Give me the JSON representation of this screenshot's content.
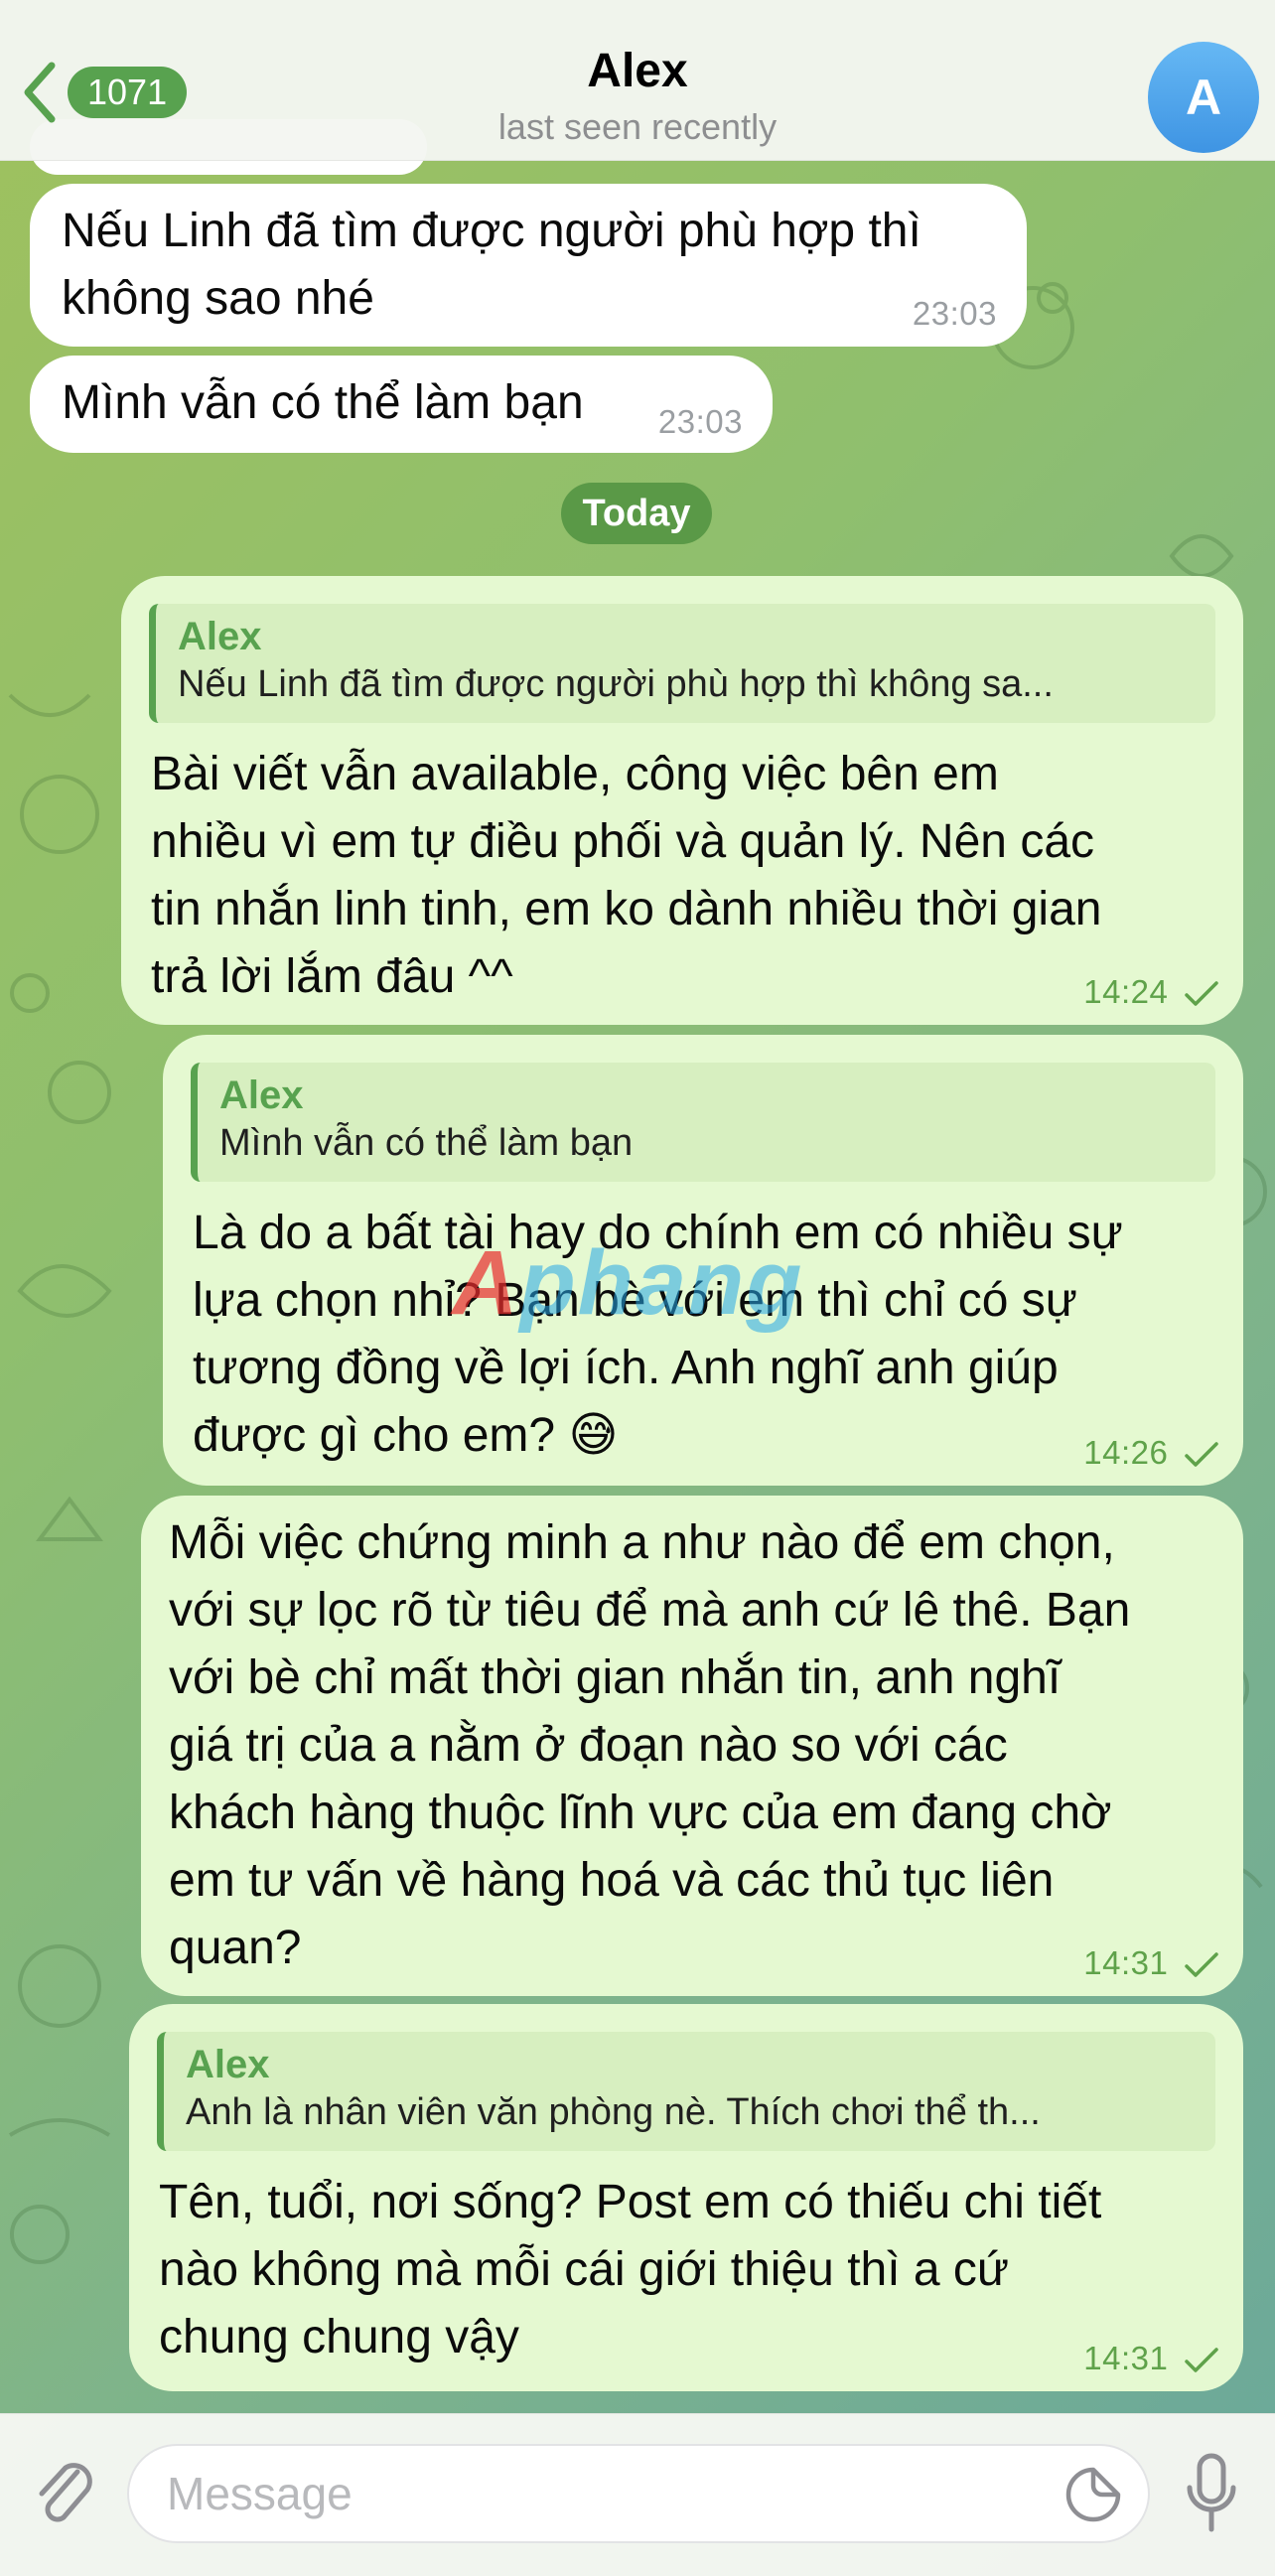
{
  "header": {
    "unread_count": "1071",
    "contact_name": "Alex",
    "status": "last seen recently",
    "avatar_letter": "A"
  },
  "messages": {
    "m1": {
      "text_line1": "Nếu Linh đã tìm được người phù hợp thì",
      "text_line2": "không sao nhé",
      "time": "23:03"
    },
    "m2": {
      "text": "Mình vẫn có thể làm bạn",
      "time": "23:03"
    },
    "day_separator": "Today",
    "m3": {
      "reply_name": "Alex",
      "reply_text": "Nếu Linh đã tìm được người phù hợp thì không sa...",
      "lines": [
        "Bài viết vẫn available, công việc bên em",
        "nhiều vì em tự điều phối và quản lý. Nên các",
        "tin nhắn linh tinh, em ko dành nhiều thời gian",
        "trả lời lắm đâu ^^"
      ],
      "time": "14:24"
    },
    "m4": {
      "reply_name": "Alex",
      "reply_text": "Mình vẫn có thể làm bạn",
      "lines": [
        "Là do a bất tài hay do chính em có nhiều sự",
        "lựa chọn nhỉ? Bạn bè với em thì chỉ có sự",
        "tương đồng về lợi ích. Anh nghĩ anh giúp",
        "được gì cho em? 😅"
      ],
      "time": "14:26"
    },
    "m5": {
      "lines": [
        "Mỗi việc chứng minh a như nào để em chọn,",
        "với sự lọc rõ từ tiêu để mà anh cứ lê thê. Bạn",
        "với bè chỉ mất thời gian nhắn tin, anh nghĩ",
        "giá trị của a nằm ở đoạn nào so với các",
        "khách hàng thuộc lĩnh vực của em đang chờ",
        "em tư vấn về hàng hoá và các thủ tục liên",
        "quan?"
      ],
      "time": "14:31"
    },
    "m6": {
      "reply_name": "Alex",
      "reply_text": "Anh là nhân viên văn phòng nè. Thích chơi thể th...",
      "lines": [
        "Tên, tuổi, nơi sống? Post em có thiếu chi tiết",
        "nào không mà mỗi cái giới thiệu thì a cứ",
        "chung chung vậy"
      ],
      "time": "14:31"
    }
  },
  "watermark": {
    "prefix": "A",
    "text": "phang"
  },
  "composer": {
    "placeholder": "Message",
    "value": ""
  },
  "icons": {
    "back": "chevron-left-icon",
    "attach": "paperclip-icon",
    "sticker": "sticker-icon",
    "mic": "microphone-icon",
    "read": "checkmark-icon"
  },
  "colors": {
    "accent": "#58a24f",
    "outgoing_bubble": "#e5f9d1",
    "incoming_bubble": "#ffffff",
    "avatar": "#4aa0ea"
  }
}
